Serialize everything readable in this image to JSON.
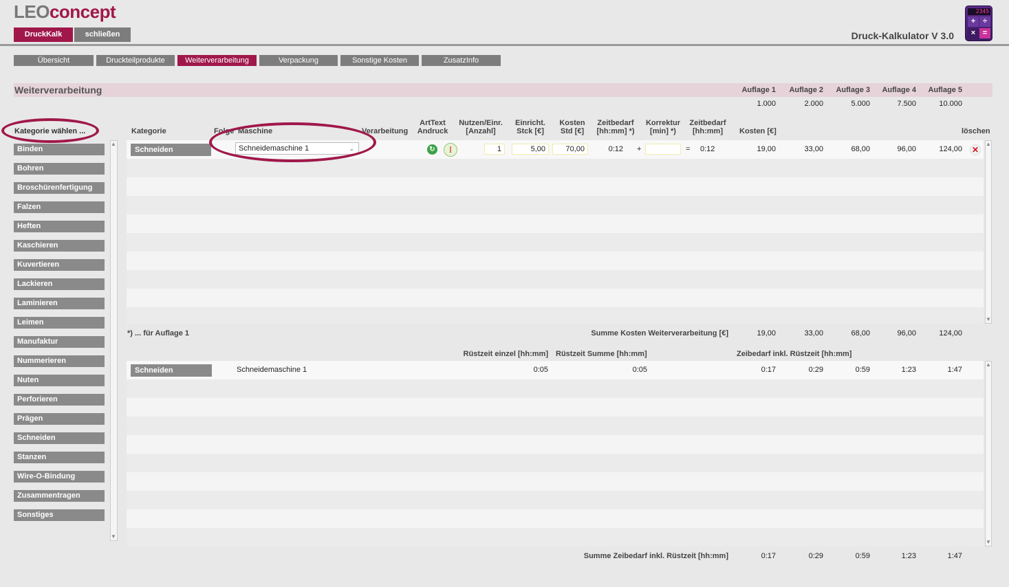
{
  "header": {
    "logo_left": "LEO",
    "logo_right": "concept",
    "btn_druckkalk": "DruckKalk",
    "btn_close": "schließen",
    "app_title": "Druck-Kalkulator V 3.0",
    "calc_display": "2345"
  },
  "colors": {
    "accent": "#a0184a",
    "button_gray": "#7d7d7d",
    "band": "#e6d3d9"
  },
  "tabs": [
    "Übersicht",
    "Druckteilprodukte",
    "Weiterverarbeitung",
    "Verpackung",
    "Sonstige Kosten",
    "ZusatzInfo"
  ],
  "active_tab": "Weiterverarbeitung",
  "section": {
    "title": "Weiterverarbeitung",
    "auflagen": [
      {
        "label": "Auflage 1",
        "qty": "1.000"
      },
      {
        "label": "Auflage 2",
        "qty": "2.000"
      },
      {
        "label": "Auflage 3",
        "qty": "5.000"
      },
      {
        "label": "Auflage 4",
        "qty": "7.500"
      },
      {
        "label": "Auflage 5",
        "qty": "10.000"
      }
    ]
  },
  "sidebar": {
    "title": "Kategorie wählen ...",
    "items": [
      "Binden",
      "Bohren",
      "Broschürenfertigung",
      "Falzen",
      "Heften",
      "Kaschieren",
      "Kuvertieren",
      "Lackieren",
      "Laminieren",
      "Leimen",
      "Manufaktur",
      "Nummerieren",
      "Nuten",
      "Perforieren",
      "Prägen",
      "Schneiden",
      "Stanzen",
      "Wire-O-Bindung",
      "Zusammentragen",
      "Sonstiges"
    ]
  },
  "columns": {
    "kategorie": "Kategorie",
    "folge": "Folge",
    "maschine": "Maschine",
    "verarbeitung": "Verarbeitung",
    "arttext_1": "ArtText",
    "arttext_2": "Andruck",
    "nutzen_1": "Nutzen/Einr.",
    "nutzen_2": "[Anzahl]",
    "einricht_1": "Einricht.",
    "einricht_2": "Stck [€]",
    "kosten_1": "Kosten",
    "kosten_2": "Std [€]",
    "zeit_1": "Zeitbedarf",
    "zeit_2": "[hh:mm] *)",
    "korr_1": "Korrektur",
    "korr_2": "[min] *)",
    "zeit2_1": "Zeitbedarf",
    "zeit2_2": "[hh:mm]",
    "kosten_eur": "Kosten [€]",
    "loeschen": "löschen"
  },
  "row1": {
    "kategorie": "Schneiden",
    "maschine": "Schneidemaschine 1",
    "nutzen": "1",
    "einricht": "5,00",
    "kosten_std": "70,00",
    "zeitbedarf": "0:12",
    "plus": "+",
    "korrektur": "",
    "equals": "=",
    "zeitbedarf2": "0:12",
    "kosten": [
      "19,00",
      "33,00",
      "68,00",
      "96,00",
      "124,00"
    ]
  },
  "summary": {
    "footnote": "*) ... für Auflage 1",
    "sum_label": "Summe Kosten Weiterverarbeitung [€]",
    "sum_values": [
      "19,00",
      "33,00",
      "68,00",
      "96,00",
      "124,00"
    ]
  },
  "lower": {
    "col_ruest_einzel": "Rüstzeit einzel [hh:mm]",
    "col_ruest_summe": "Rüstzeit Summe [hh:mm]",
    "col_zeit_inkl": "Zeibedarf inkl. Rüstzeit [hh:mm]",
    "row": {
      "kategorie": "Schneiden",
      "maschine": "Schneidemaschine 1",
      "ruest_einzel": "0:05",
      "ruest_summe": "0:05",
      "zeiten": [
        "0:17",
        "0:29",
        "0:59",
        "1:23",
        "1:47"
      ]
    },
    "sum_label": "Summe Zeibedarf inkl. Rüstzeit [hh:mm]",
    "sum_values": [
      "0:17",
      "0:29",
      "0:59",
      "1:23",
      "1:47"
    ]
  }
}
